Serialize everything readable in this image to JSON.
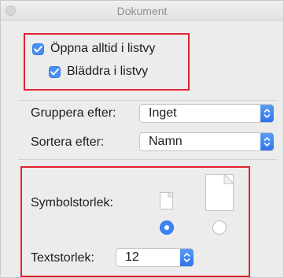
{
  "window": {
    "title": "Dokument"
  },
  "view_options": {
    "always_open_list": {
      "label": "Öppna alltid i listvy",
      "checked": true
    },
    "browse_list": {
      "label": "Bläddra i listvy",
      "checked": true
    }
  },
  "group_by": {
    "label": "Gruppera efter:",
    "value": "Inget"
  },
  "sort_by": {
    "label": "Sortera efter:",
    "value": "Namn"
  },
  "icon_size": {
    "label": "Symbolstorlek:",
    "options": [
      "small",
      "large"
    ],
    "selected": "small"
  },
  "text_size": {
    "label": "Textstorlek:",
    "value": "12"
  },
  "colors": {
    "accent": "#3d86f6",
    "highlight": "#e0242e"
  },
  "icons": [
    "checkbox-check-icon",
    "stepper-chevron-icon",
    "document-small-icon",
    "document-large-icon"
  ]
}
